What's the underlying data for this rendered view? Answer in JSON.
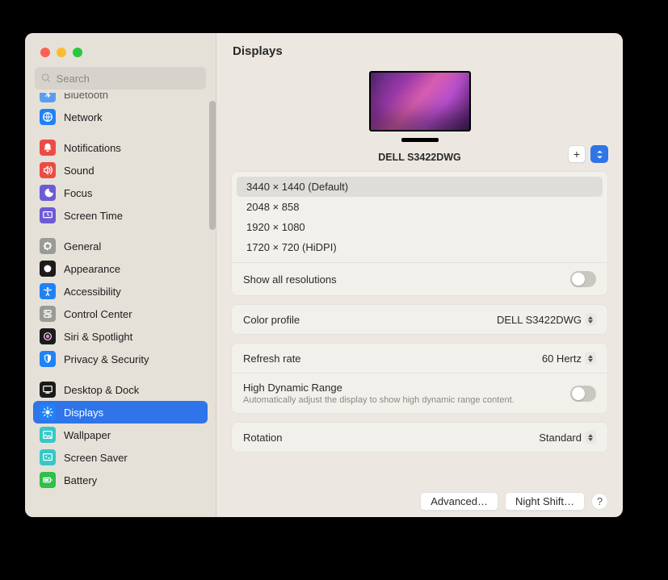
{
  "search": {
    "placeholder": "Search"
  },
  "sidebar": {
    "bluetooth": "Bluetooth",
    "items1": [
      {
        "label": "Network",
        "color": "#1f82f7"
      }
    ],
    "items2": [
      {
        "label": "Notifications",
        "color": "#ec4b44"
      },
      {
        "label": "Sound",
        "color": "#ec4b44"
      },
      {
        "label": "Focus",
        "color": "#6d5bd6"
      },
      {
        "label": "Screen Time",
        "color": "#6d5bd6"
      }
    ],
    "items3": [
      {
        "label": "General",
        "color": "#9a9a98"
      },
      {
        "label": "Appearance",
        "color": "#1b1b1b"
      },
      {
        "label": "Accessibility",
        "color": "#1f82f7"
      },
      {
        "label": "Control Center",
        "color": "#9a9a98"
      },
      {
        "label": "Siri & Spotlight",
        "color": "#1b1b1b"
      },
      {
        "label": "Privacy & Security",
        "color": "#1f82f7"
      }
    ],
    "items4": [
      {
        "label": "Desktop & Dock",
        "color": "#1b1b1b"
      },
      {
        "label": "Displays",
        "color": "#1f82f7",
        "selected": true
      },
      {
        "label": "Wallpaper",
        "color": "#35c8c8"
      },
      {
        "label": "Screen Saver",
        "color": "#35c8c8"
      },
      {
        "label": "Battery",
        "color": "#2fbf4a"
      }
    ]
  },
  "main": {
    "title": "Displays",
    "monitor_name": "DELL S3422DWG",
    "resolutions": [
      "3440 × 1440 (Default)",
      "2048 × 858",
      "1920 × 1080",
      "1720 × 720 (HiDPI)"
    ],
    "show_all": "Show all resolutions",
    "color_profile_label": "Color profile",
    "color_profile_value": "DELL S3422DWG",
    "refresh_label": "Refresh rate",
    "refresh_value": "60 Hertz",
    "hdr_label": "High Dynamic Range",
    "hdr_sub": "Automatically adjust the display to show high dynamic range content.",
    "rotation_label": "Rotation",
    "rotation_value": "Standard",
    "advanced": "Advanced…",
    "night_shift": "Night Shift…"
  }
}
